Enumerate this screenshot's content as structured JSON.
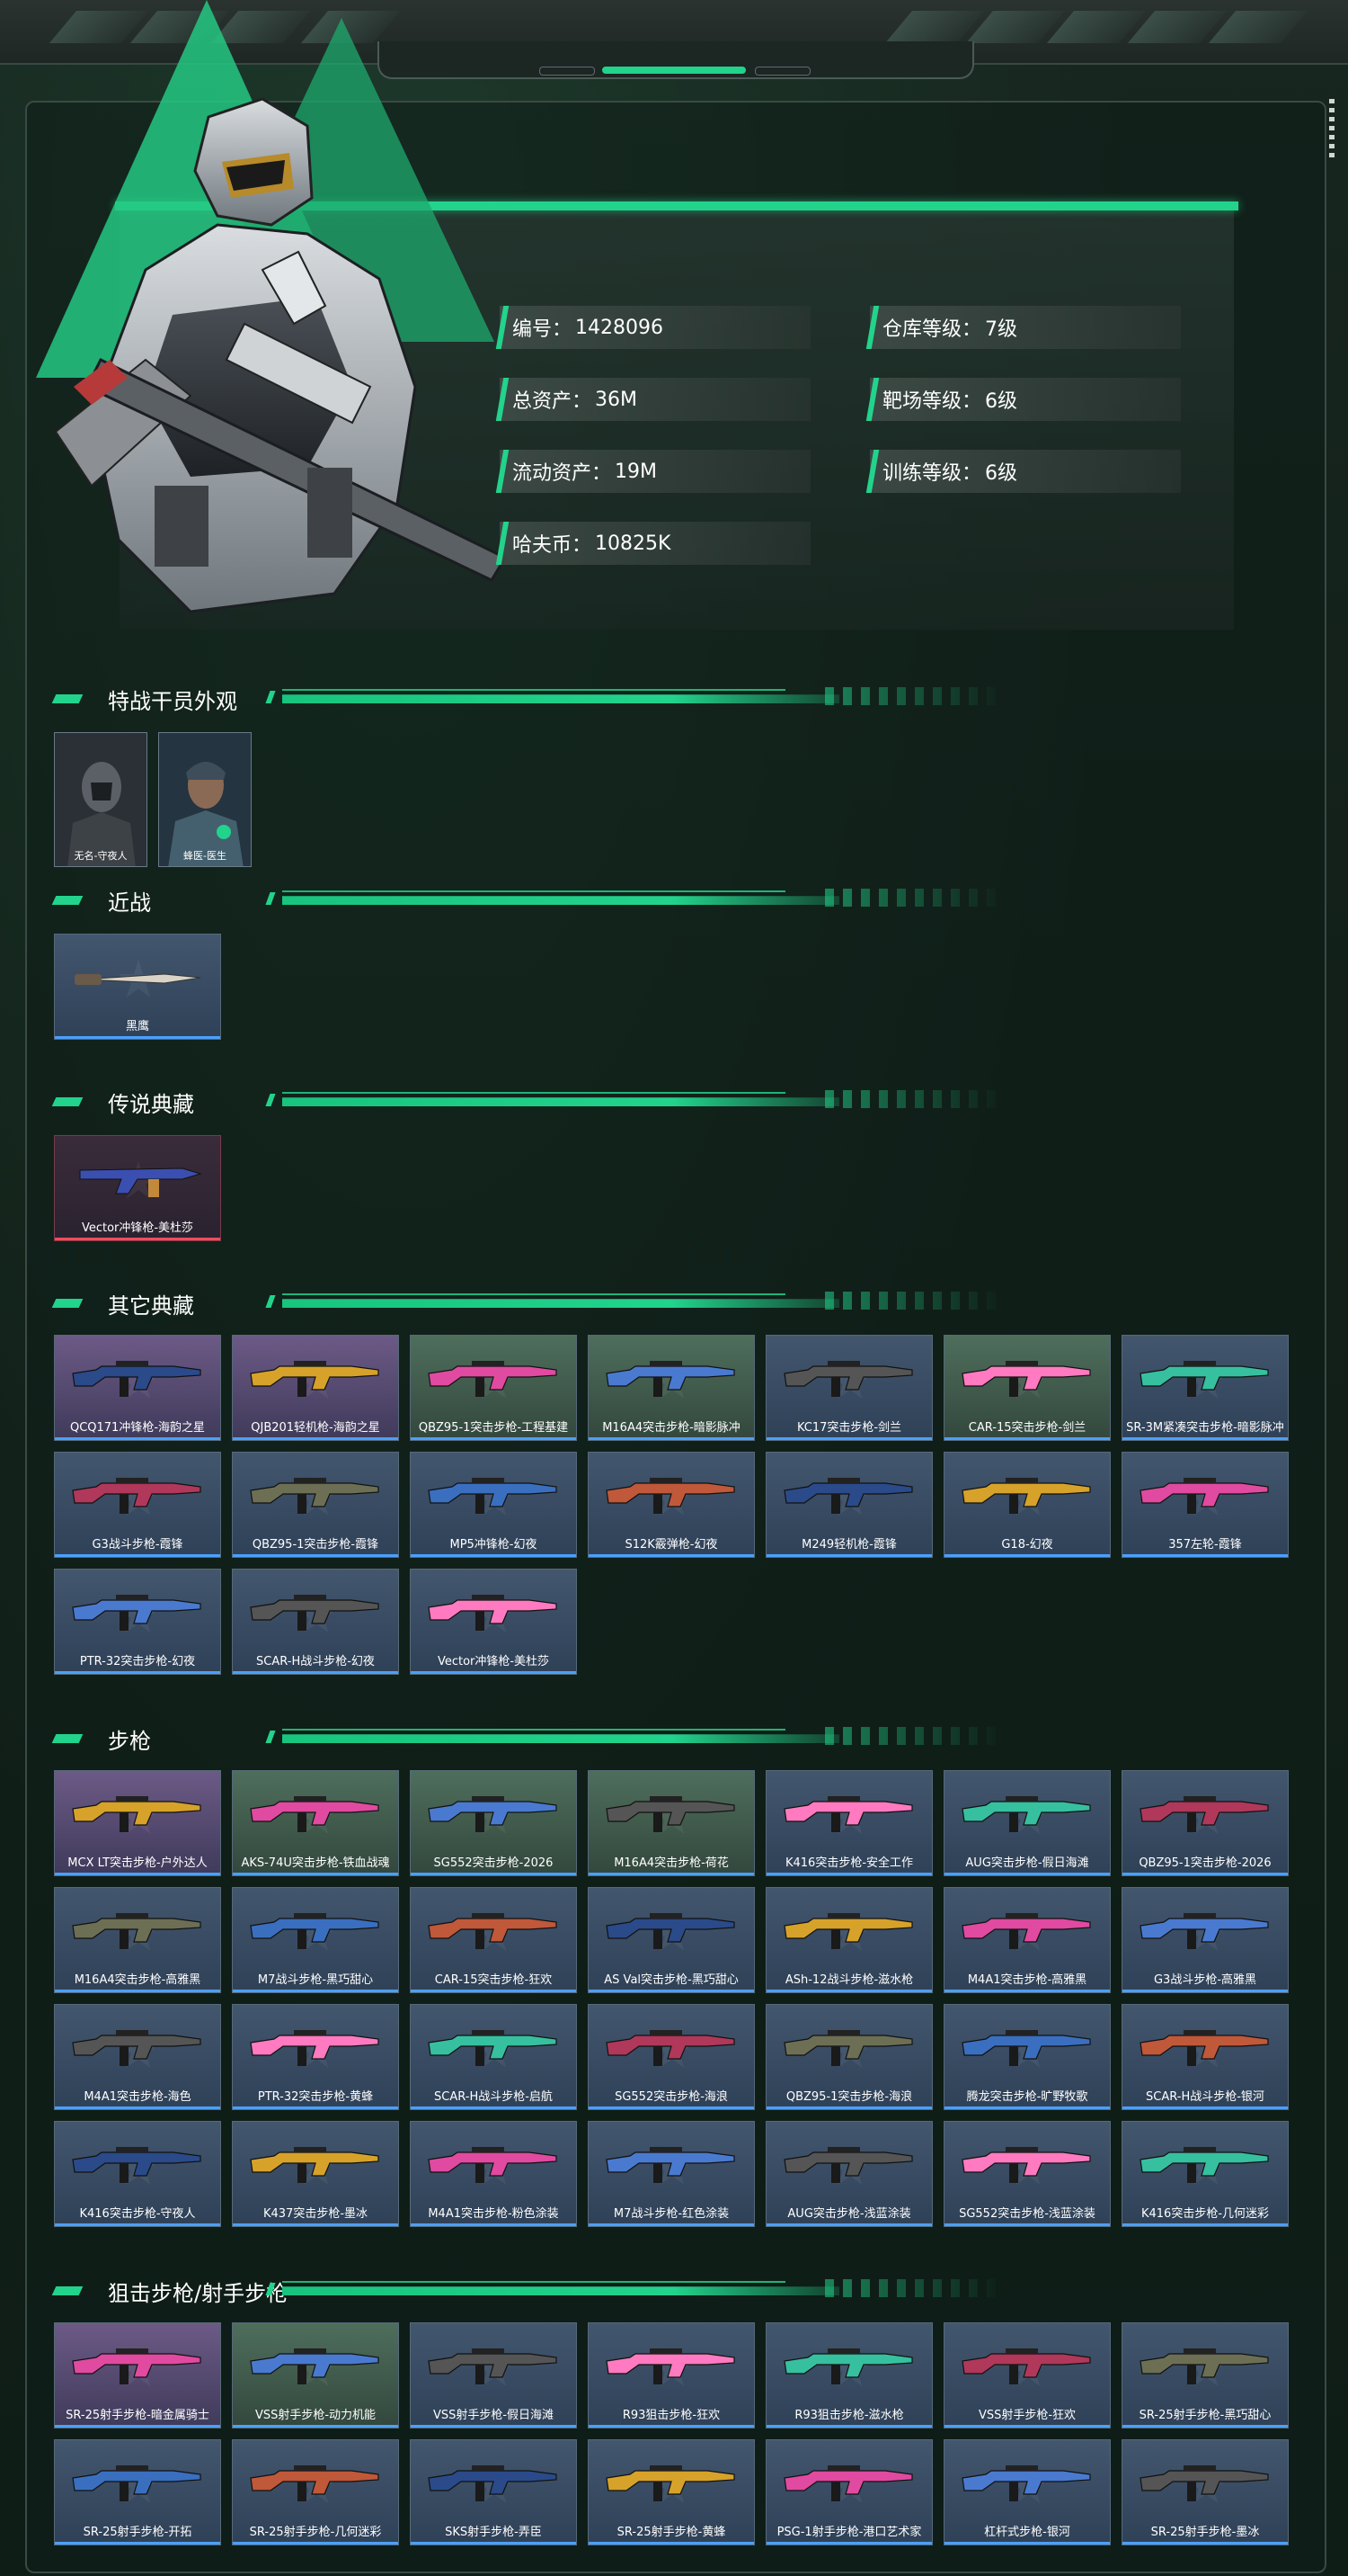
{
  "profile": {
    "stats": [
      {
        "label": "编号：",
        "value": "1428096"
      },
      {
        "label": "仓库等级：",
        "value": "7级"
      },
      {
        "label": "总资产：",
        "value": "36M"
      },
      {
        "label": "靶场等级：",
        "value": "6级"
      },
      {
        "label": "流动资产：",
        "value": "19M"
      },
      {
        "label": "训练等级：",
        "value": "6级"
      },
      {
        "label": "哈夫币：",
        "value": "10825K"
      }
    ]
  },
  "sections": [
    {
      "title": "特战干员外观",
      "items": [
        "无名-守夜人",
        "蜂医-医生"
      ]
    },
    {
      "title": "近战",
      "items": [
        "黑鹰"
      ]
    },
    {
      "title": "传说典藏",
      "items": [
        "Vector冲锋枪-美杜莎"
      ]
    },
    {
      "title": "其它典藏",
      "items": [
        "QCQ171冲锋枪-海韵之星",
        "QJB201轻机枪-海韵之星",
        "QBZ95-1突击步枪-工程基建",
        "M16A4突击步枪-暗影脉冲",
        "KC17突击步枪-剑兰",
        "CAR-15突击步枪-剑兰",
        "SR-3M紧凑突击步枪-暗影脉冲",
        "G3战斗步枪-霞锋",
        "QBZ95-1突击步枪-霞锋",
        "MP5冲锋枪-幻夜",
        "S12K霰弹枪-幻夜",
        "M249轻机枪-霞锋",
        "G18-幻夜",
        "357左轮-霞锋",
        "PTR-32突击步枪-幻夜",
        "SCAR-H战斗步枪-幻夜",
        "Vector冲锋枪-美杜莎"
      ]
    },
    {
      "title": "步枪",
      "items": [
        "MCX LT突击步枪-户外达人",
        "AKS-74U突击步枪-铁血战魂",
        "SG552突击步枪-2026",
        "M16A4突击步枪-荷花",
        "K416突击步枪-安全工作",
        "AUG突击步枪-假日海滩",
        "QBZ95-1突击步枪-2026",
        "M16A4突击步枪-高雅黑",
        "M7战斗步枪-黑巧甜心",
        "CAR-15突击步枪-狂欢",
        "AS Val突击步枪-黑巧甜心",
        "ASh-12战斗步枪-滋水枪",
        "M4A1突击步枪-高雅黑",
        "G3战斗步枪-高雅黑",
        "M4A1突击步枪-海色",
        "PTR-32突击步枪-黄蜂",
        "SCAR-H战斗步枪-启航",
        "SG552突击步枪-海浪",
        "QBZ95-1突击步枪-海浪",
        "腾龙突击步枪-旷野牧歌",
        "SCAR-H战斗步枪-银河",
        "K416突击步枪-守夜人",
        "K437突击步枪-墨冰",
        "M4A1突击步枪-粉色涂装",
        "M7战斗步枪-红色涂装",
        "AUG突击步枪-浅蓝涂装",
        "SG552突击步枪-浅蓝涂装",
        "K416突击步枪-几何迷彩"
      ]
    },
    {
      "title": "狙击步枪/射手步枪",
      "items": [
        "SR-25射手步枪-暗金属骑士",
        "VSS射手步枪-动力机能",
        "VSS射手步枪-假日海滩",
        "R93狙击步枪-狂欢",
        "R93狙击步枪-滋水枪",
        "VSS射手步枪-狂欢",
        "SR-25射手步枪-黑巧甜心",
        "SR-25射手步枪-开拓",
        "SR-25射手步枪-几何迷彩",
        "SKS射手步枪-弄臣",
        "SR-25射手步枪-黄蜂",
        "PSG-1射手步枪-港口艺术家",
        "杠杆式步枪-银河",
        "SR-25射手步枪-墨冰"
      ]
    }
  ],
  "colors": {
    "accent": "#22d38c",
    "rare_blue": "#4aa0ff",
    "legend_red": "#ff4a5a"
  }
}
